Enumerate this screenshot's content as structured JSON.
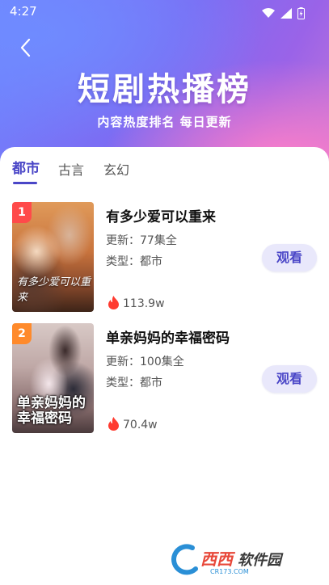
{
  "status_bar": {
    "time": "4:27"
  },
  "header": {
    "title": "短剧热播榜",
    "subtitle": "内容热度排名 每日更新"
  },
  "tabs": [
    {
      "label": "都市",
      "active": true
    },
    {
      "label": "古言",
      "active": false
    },
    {
      "label": "玄幻",
      "active": false
    }
  ],
  "items": [
    {
      "rank": "1",
      "rank_color": "#ff4a4a",
      "title": "有多少爱可以重来",
      "update": "更新：77集全",
      "type": "类型：都市",
      "heat": "113.9w",
      "watch_label": "观看",
      "cover_text": "有多少爱可以重来"
    },
    {
      "rank": "2",
      "rank_color": "#ff8a2b",
      "title": "单亲妈妈的幸福密码",
      "update": "更新：100集全",
      "type": "类型：都市",
      "heat": "70.4w",
      "watch_label": "观看",
      "cover_text": "单亲妈妈的幸福密码"
    }
  ],
  "watermark": {
    "brand": "西西软件园",
    "site": "CR173.COM"
  },
  "colors": {
    "accent": "#4a46c7",
    "button_bg": "#e9e8fb",
    "flame": "#ff3b30"
  }
}
